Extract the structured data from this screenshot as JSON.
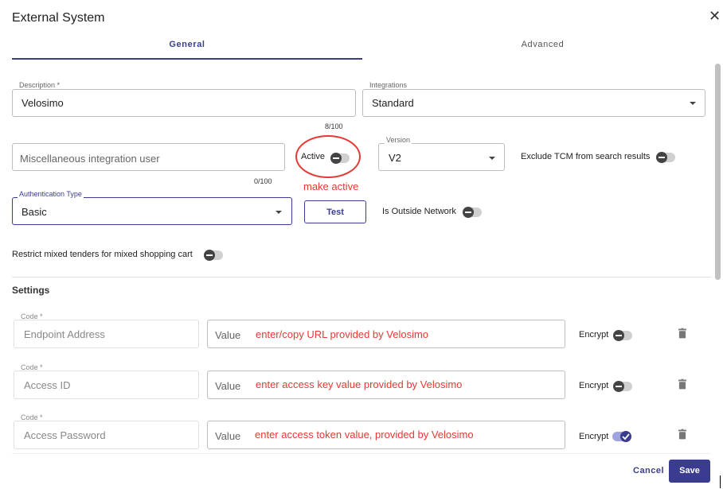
{
  "dialog": {
    "title": "External System",
    "close_icon": "close-icon"
  },
  "tabs": [
    {
      "label": "General"
    },
    {
      "label": "Advanced"
    }
  ],
  "general": {
    "description": {
      "label": "Description *",
      "value": "Velosimo",
      "counter": "8/100"
    },
    "integrations": {
      "label": "Integrations",
      "value": "Standard"
    },
    "user": {
      "placeholder": "Miscellaneous integration user",
      "counter": "0/100"
    },
    "active": {
      "label": "Active",
      "annotation": "make active"
    },
    "version": {
      "label": "Version",
      "value": "V2"
    },
    "exclude_tcm": {
      "label": "Exclude TCM from search results"
    },
    "auth_type": {
      "label": "Authentication Type",
      "value": "Basic"
    },
    "test_button": "Test",
    "outside_network": {
      "label": "Is Outside Network"
    },
    "restrict_mixed": {
      "label": "Restrict mixed tenders for mixed shopping cart"
    }
  },
  "settings": {
    "title": "Settings",
    "rows": [
      {
        "code_label": "Code *",
        "code": "Endpoint Address",
        "value_label": "Value",
        "annotation": "enter/copy URL provided by Velosimo",
        "encrypt_label": "Encrypt",
        "encrypt_on": false
      },
      {
        "code_label": "Code *",
        "code": "Access ID",
        "value_label": "Value",
        "annotation": "enter access key value provided by Velosimo",
        "encrypt_label": "Encrypt",
        "encrypt_on": false
      },
      {
        "code_label": "Code *",
        "code": "Access Password",
        "value_label": "Value",
        "annotation": "enter access token value, provided by Velosimo",
        "encrypt_label": "Encrypt",
        "encrypt_on": true
      }
    ]
  },
  "footer": {
    "cancel": "Cancel",
    "save": "Save"
  },
  "colors": {
    "accent": "#3a3d8f",
    "annotation_red": "#e53935"
  }
}
